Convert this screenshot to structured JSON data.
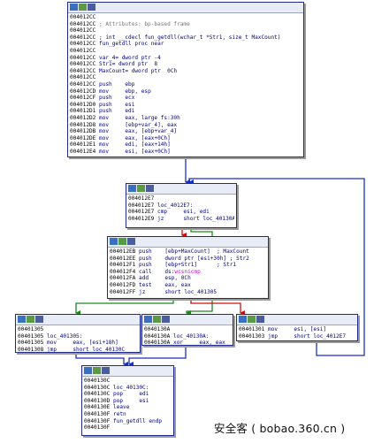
{
  "nodes": {
    "entry": {
      "lines": [
        [
          {
            "t": "004012CC",
            "c": "ad"
          }
        ],
        [
          {
            "t": "004012CC",
            "c": "ad"
          },
          {
            "t": " ; Attributes: bp-based frame",
            "c": "cm"
          }
        ],
        [
          {
            "t": "004012CC",
            "c": "ad"
          }
        ],
        [
          {
            "t": "004012CC",
            "c": "ad"
          },
          {
            "t": " ; int __cdecl fun_getdll(wchar_t *Str1, size_t MaxCount)",
            "c": "lb"
          }
        ],
        [
          {
            "t": "004012CC",
            "c": "ad"
          },
          {
            "t": " fun_getdll proc near",
            "c": "lb"
          }
        ],
        [
          {
            "t": "004012CC",
            "c": "ad"
          }
        ],
        [
          {
            "t": "004012CC",
            "c": "ad"
          },
          {
            "t": " var_4= dword ptr -4",
            "c": "lb"
          }
        ],
        [
          {
            "t": "004012CC",
            "c": "ad"
          },
          {
            "t": " Str1= dword ptr  8",
            "c": "lb"
          }
        ],
        [
          {
            "t": "004012CC",
            "c": "ad"
          },
          {
            "t": " MaxCount= dword ptr  0Ch",
            "c": "lb"
          }
        ],
        [
          {
            "t": "004012CC",
            "c": "ad"
          }
        ],
        [
          {
            "t": "004012CC",
            "c": "ad"
          },
          {
            "t": " push    ",
            "c": "mn"
          },
          {
            "t": "ebp",
            "c": "op"
          }
        ],
        [
          {
            "t": "004012CD",
            "c": "ad"
          },
          {
            "t": " mov     ",
            "c": "mn"
          },
          {
            "t": "ebp, esp",
            "c": "op"
          }
        ],
        [
          {
            "t": "004012CF",
            "c": "ad"
          },
          {
            "t": " push    ",
            "c": "mn"
          },
          {
            "t": "ecx",
            "c": "op"
          }
        ],
        [
          {
            "t": "004012D0",
            "c": "ad"
          },
          {
            "t": " push    ",
            "c": "mn"
          },
          {
            "t": "esi",
            "c": "op"
          }
        ],
        [
          {
            "t": "004012D1",
            "c": "ad"
          },
          {
            "t": " push    ",
            "c": "mn"
          },
          {
            "t": "edi",
            "c": "op"
          }
        ],
        [
          {
            "t": "004012D2",
            "c": "ad"
          },
          {
            "t": " mov     ",
            "c": "mn"
          },
          {
            "t": "eax, large fs:30h",
            "c": "op"
          }
        ],
        [
          {
            "t": "004012D8",
            "c": "ad"
          },
          {
            "t": " mov     ",
            "c": "mn"
          },
          {
            "t": "[ebp+var_4], eax",
            "c": "op"
          }
        ],
        [
          {
            "t": "004012DB",
            "c": "ad"
          },
          {
            "t": " mov     ",
            "c": "mn"
          },
          {
            "t": "eax, [ebp+var_4]",
            "c": "op"
          }
        ],
        [
          {
            "t": "004012DE",
            "c": "ad"
          },
          {
            "t": " mov     ",
            "c": "mn"
          },
          {
            "t": "eax, [eax+0Ch]",
            "c": "op"
          }
        ],
        [
          {
            "t": "004012E1",
            "c": "ad"
          },
          {
            "t": " mov     ",
            "c": "mn"
          },
          {
            "t": "edi, [eax+14h]",
            "c": "op"
          }
        ],
        [
          {
            "t": "004012E4",
            "c": "ad"
          },
          {
            "t": " mov     ",
            "c": "mn"
          },
          {
            "t": "esi, [eax+0Ch]",
            "c": "op"
          }
        ]
      ]
    },
    "loop": {
      "lines": [
        [
          {
            "t": "004012E7",
            "c": "ad"
          }
        ],
        [
          {
            "t": "004012E7",
            "c": "ad"
          },
          {
            "t": " loc_4012E7:",
            "c": "lb"
          }
        ],
        [
          {
            "t": "004012E7",
            "c": "ad"
          },
          {
            "t": " cmp     ",
            "c": "mn"
          },
          {
            "t": "esi, edi",
            "c": "op"
          }
        ],
        [
          {
            "t": "004012E9",
            "c": "ad"
          },
          {
            "t": " jz      ",
            "c": "mn"
          },
          {
            "t": "short loc_40130A",
            "c": "op"
          }
        ]
      ]
    },
    "body": {
      "lines": [
        [
          {
            "t": "004012EB",
            "c": "ad"
          },
          {
            "t": " push    ",
            "c": "mn"
          },
          {
            "t": "[ebp+MaxCount]  ; MaxCount",
            "c": "op"
          }
        ],
        [
          {
            "t": "004012EE",
            "c": "ad"
          },
          {
            "t": " push    ",
            "c": "mn"
          },
          {
            "t": "dword ptr [esi+30h] ; Str2",
            "c": "op"
          }
        ],
        [
          {
            "t": "004012F1",
            "c": "ad"
          },
          {
            "t": " push    ",
            "c": "mn"
          },
          {
            "t": "[ebp+Str1]      ; Str1",
            "c": "op"
          }
        ],
        [
          {
            "t": "004012F4",
            "c": "ad"
          },
          {
            "t": " call    ",
            "c": "mn"
          },
          {
            "t": "ds:",
            "c": "op"
          },
          {
            "t": "wcsnicmp",
            "c": "pk"
          }
        ],
        [
          {
            "t": "004012FA",
            "c": "ad"
          },
          {
            "t": " add     ",
            "c": "mn"
          },
          {
            "t": "esp, 0Ch",
            "c": "op"
          }
        ],
        [
          {
            "t": "004012FD",
            "c": "ad"
          },
          {
            "t": " test    ",
            "c": "mn"
          },
          {
            "t": "eax, eax",
            "c": "op"
          }
        ],
        [
          {
            "t": "004012FF",
            "c": "ad"
          },
          {
            "t": " jz      ",
            "c": "mn"
          },
          {
            "t": "short loc_401305",
            "c": "op"
          }
        ]
      ]
    },
    "found": {
      "lines": [
        [
          {
            "t": "00401305",
            "c": "ad"
          }
        ],
        [
          {
            "t": "00401305",
            "c": "ad"
          },
          {
            "t": " loc_401305:",
            "c": "lb"
          }
        ],
        [
          {
            "t": "00401305",
            "c": "ad"
          },
          {
            "t": " mov     ",
            "c": "mn"
          },
          {
            "t": "eax, [esi+18h]",
            "c": "op"
          }
        ],
        [
          {
            "t": "00401308",
            "c": "ad"
          },
          {
            "t": " jmp     ",
            "c": "mn"
          },
          {
            "t": "short loc_40130C",
            "c": "op"
          }
        ]
      ]
    },
    "notfound": {
      "lines": [
        [
          {
            "t": "0040130A",
            "c": "ad"
          }
        ],
        [
          {
            "t": "0040130A",
            "c": "ad"
          },
          {
            "t": " loc_40130A:",
            "c": "lb"
          }
        ],
        [
          {
            "t": "0040130A",
            "c": "ad"
          },
          {
            "t": " xor     ",
            "c": "mn"
          },
          {
            "t": "eax, eax",
            "c": "op"
          }
        ]
      ]
    },
    "next": {
      "lines": [
        [
          {
            "t": "00401301",
            "c": "ad"
          },
          {
            "t": " mov     ",
            "c": "mn"
          },
          {
            "t": "esi, [esi]",
            "c": "op"
          }
        ],
        [
          {
            "t": "00401303",
            "c": "ad"
          },
          {
            "t": " jmp     ",
            "c": "mn"
          },
          {
            "t": "short loc_4012E7",
            "c": "op"
          }
        ]
      ]
    },
    "exit": {
      "lines": [
        [
          {
            "t": "0040130C",
            "c": "ad"
          }
        ],
        [
          {
            "t": "0040130C",
            "c": "ad"
          },
          {
            "t": " loc_40130C:",
            "c": "lb"
          }
        ],
        [
          {
            "t": "0040130C",
            "c": "ad"
          },
          {
            "t": " pop     ",
            "c": "mn"
          },
          {
            "t": "edi",
            "c": "op"
          }
        ],
        [
          {
            "t": "0040130D",
            "c": "ad"
          },
          {
            "t": " pop     ",
            "c": "mn"
          },
          {
            "t": "esi",
            "c": "op"
          }
        ],
        [
          {
            "t": "0040130E",
            "c": "ad"
          },
          {
            "t": " leave",
            "c": "mn"
          }
        ],
        [
          {
            "t": "0040130F",
            "c": "ad"
          },
          {
            "t": " retn",
            "c": "mn"
          }
        ],
        [
          {
            "t": "0040130F",
            "c": "ad"
          },
          {
            "t": " fun_getdll endp",
            "c": "lb"
          }
        ],
        [
          {
            "t": "0040130F",
            "c": "ad"
          }
        ]
      ]
    }
  },
  "edge_colors": {
    "true_branch": "#1a8a1a",
    "false_branch": "#cc1010",
    "unconditional": "#1a2fc0"
  },
  "icons": [
    "graph-node-color-icon",
    "graph-node-view-icon",
    "graph-node-list-icon"
  ],
  "watermark": "安全客 ( bobao.360.cn )"
}
